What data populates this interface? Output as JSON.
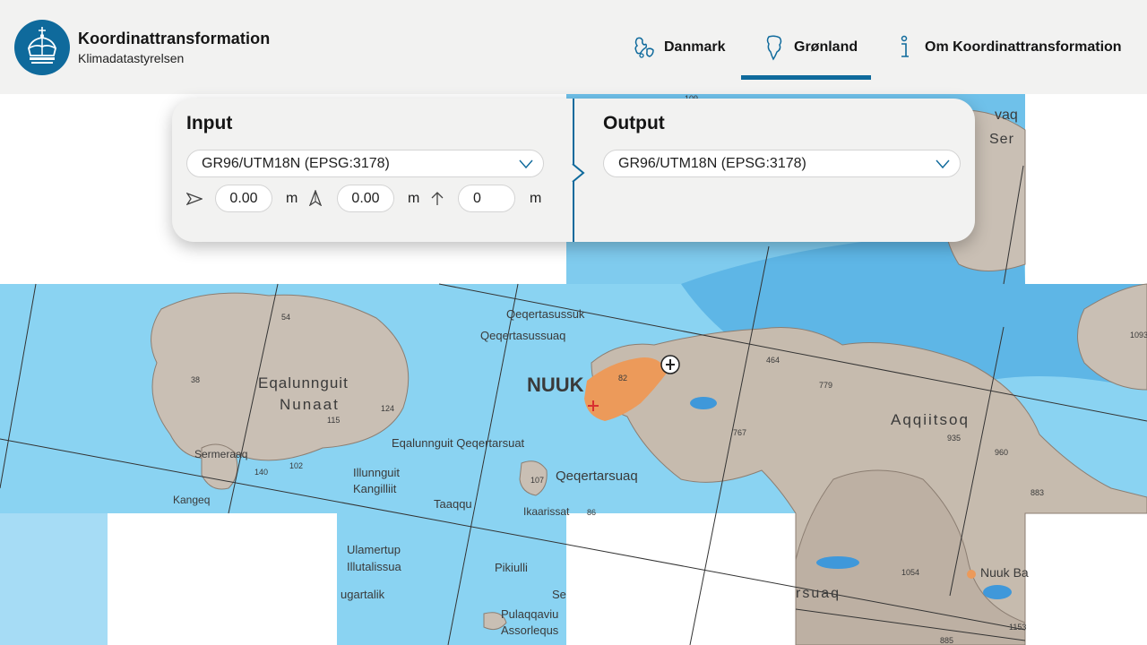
{
  "header": {
    "title": "Koordinattransformation",
    "subtitle": "Klimadatastyrelsen",
    "logo_icon": "crown-icon",
    "nav": [
      {
        "label": "Danmark",
        "icon": "denmark-map-icon",
        "active": false
      },
      {
        "label": "Grønland",
        "icon": "greenland-map-icon",
        "active": true
      },
      {
        "label": "Om Koordinattransformation",
        "icon": "info-icon",
        "active": false
      }
    ]
  },
  "panel": {
    "input": {
      "title": "Input",
      "crs": "GR96/UTM18N (EPSG:3178)",
      "easting": "0.00",
      "northing": "0.00",
      "height": "0",
      "unit": "m"
    },
    "output": {
      "title": "Output",
      "crs": "GR96/UTM18N (EPSG:3178)"
    }
  },
  "map": {
    "colors": {
      "sea": "#8ad3f2",
      "deep_sea": "#5eb6e6",
      "land": "#c9bfb4",
      "town": "#ec9a5a",
      "grid": "#333333"
    },
    "labels": {
      "nuuk": "NUUK",
      "qeqertasussuk": "Qeqertasussuk",
      "qeqertasussuaq": "Qeqertasussuaq",
      "eqalunnguit": "Eqalunnguit",
      "nunaat": "Nunaat",
      "eqalunnguit_qeqertarsuat": "Eqalunnguit Qeqertarsuat",
      "illunnguit": "Illunnguit",
      "kangilliit": "Kangilliit",
      "qeqertarsuaq": "Qeqertarsuaq",
      "taaqqu": "Taaqqu",
      "ikaarissat": "Ikaarissat",
      "sermeraaq": "Sermeraaq",
      "kangeq": "Kangeq",
      "ulamertup": "Ulamertup",
      "illutalissua": "Illutalissua",
      "pikiulli": "Pikiulli",
      "nugartalik": "ugartalik",
      "pulaqqaviu": "Pulaqqaviu",
      "assorlequs": "Assorlequs",
      "aqqiitsoq": "Aqqiitsoq",
      "nuuk_ba": "Nuuk Ba",
      "rsuaq": "rsuaq",
      "ser": "Ser",
      "vaq": "vaq",
      "se": "Se",
      "e54": "54",
      "e38": "38",
      "e115": "115",
      "e124": "124",
      "e140": "140",
      "e102": "102",
      "e107": "107",
      "e86": "86",
      "e82": "82",
      "e464": "464",
      "e779": "779",
      "e767": "767",
      "e935": "935",
      "e960": "960",
      "e883": "883",
      "e1093": "1093",
      "e1054": "1054",
      "e1153": "1153",
      "e885": "885",
      "e109": "109"
    }
  }
}
